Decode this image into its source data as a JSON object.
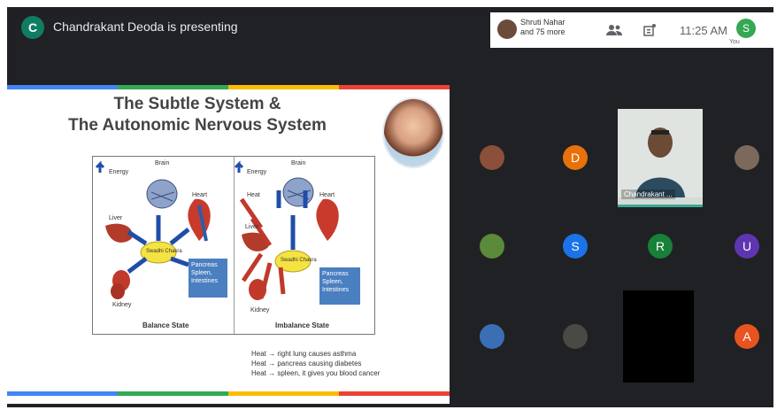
{
  "header": {
    "presenter_initial": "C",
    "presenting_text": "Chandrakant Deoda is presenting",
    "participants_line1": "Shruti Nahar",
    "participants_line2": "and 75 more",
    "time": "11:25 AM",
    "you_initial": "S",
    "you_label": "You"
  },
  "slide": {
    "title_line1": "The Subtle System &",
    "title_line2": "The Autonomic Nervous System",
    "diagram": {
      "left": {
        "labels": [
          "Energy",
          "Brain",
          "Heart",
          "Liver",
          "Kidney"
        ],
        "center_label": "Swadhi Chakra",
        "box_text": "Pancreas Spleen, Intestines",
        "caption": "Balance State"
      },
      "right": {
        "labels": [
          "Energy",
          "Heat",
          "Brain",
          "Heart",
          "Liver",
          "Kidney"
        ],
        "center_label": "Swadhi Chakra",
        "box_text": "Pancreas Spleen, Intestines",
        "caption": "Imbalance State"
      }
    },
    "notes": [
      "Heat → right lung causes asthma",
      "Heat → pancreas causing diabetes",
      "Heat → spleen, it gives you blood cancer"
    ]
  },
  "participants": [
    {
      "type": "photo",
      "label": ""
    },
    {
      "type": "letter",
      "letter": "D",
      "color": "#e8710a"
    },
    {
      "type": "camera",
      "name": "Chandrakant ..."
    },
    {
      "type": "photo",
      "label": ""
    },
    {
      "type": "photo",
      "label": ""
    },
    {
      "type": "letter",
      "letter": "S",
      "color": "#1a73e8"
    },
    {
      "type": "letter",
      "letter": "R",
      "color": "#188038"
    },
    {
      "type": "letter",
      "letter": "U",
      "color": "#5e35b1"
    },
    {
      "type": "photo",
      "label": ""
    },
    {
      "type": "photo",
      "label": ""
    },
    {
      "type": "blank",
      "label": ""
    },
    {
      "type": "letter",
      "letter": "A",
      "color": "#e8531f"
    }
  ],
  "colors": {
    "stripe": [
      "#4285f4",
      "#34a853",
      "#fbbc05",
      "#ea4335"
    ],
    "background": "#202124"
  },
  "icons": [
    "people-icon",
    "activities-icon",
    "participant-avatar"
  ]
}
